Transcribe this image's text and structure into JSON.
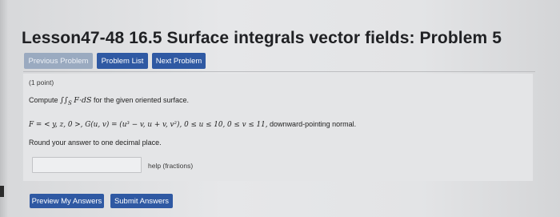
{
  "header": {
    "title": "Lesson47-48 16.5 Surface integrals vector fields: Problem 5"
  },
  "nav": {
    "previous": "Previous Problem",
    "list": "Problem List",
    "next": "Next Problem"
  },
  "problem": {
    "points": "(1 point)",
    "compute_prefix": "Compute",
    "integral": "∫∫",
    "integral_sub": "S",
    "integrand": "F·dS",
    "compute_suffix": "for the given oriented surface.",
    "field_text": "F = < y, z, 0 >, G(u, v) = (u³ − v, u + v, v²), 0 ≤ u ≤ 10, 0 ≤ v ≤ 11,",
    "orientation": "downward-pointing normal.",
    "round_instruction": "Round your answer to one decimal place.",
    "answer_value": "",
    "help_link": "help (fractions)"
  },
  "actions": {
    "preview": "Preview My Answers",
    "submit": "Submit Answers"
  },
  "colors": {
    "accent": "#2f59a3",
    "disabled_button": "#9aaac0"
  }
}
